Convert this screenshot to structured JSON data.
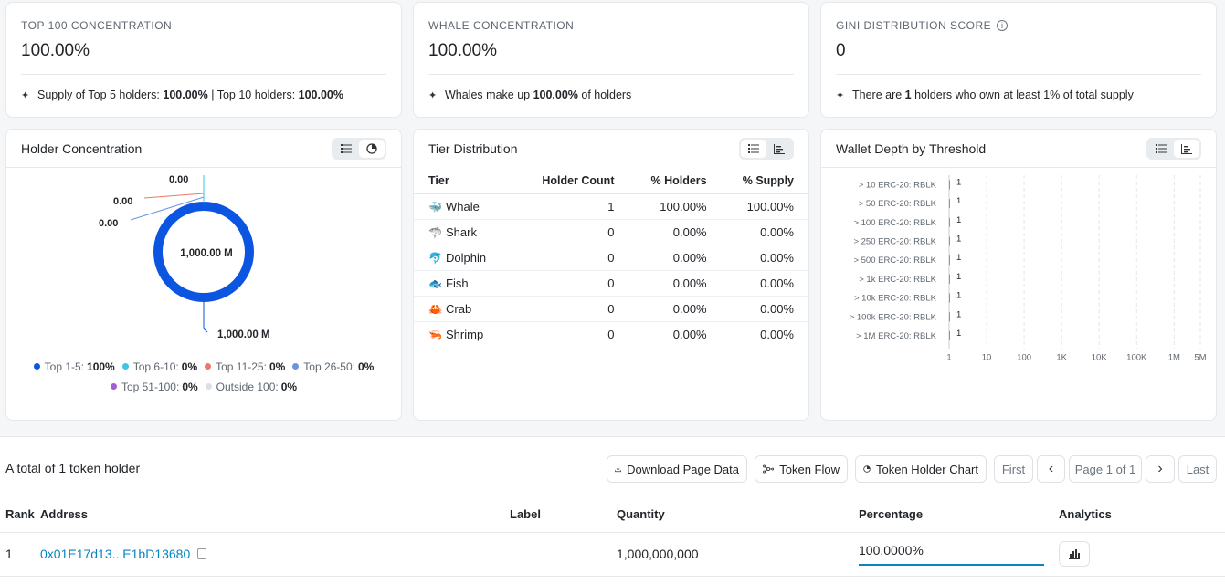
{
  "stats": [
    {
      "label": "TOP 100 CONCENTRATION",
      "value": "100.00%",
      "note": [
        {
          "t": "Supply of Top 5 holders: "
        },
        {
          "t": "100.00%",
          "b": true
        },
        {
          "t": " | Top 10 holders: "
        },
        {
          "t": "100.00%",
          "b": true
        }
      ]
    },
    {
      "label": "WHALE CONCENTRATION",
      "value": "100.00%",
      "note": [
        {
          "t": "Whales make up "
        },
        {
          "t": "100.00%",
          "b": true
        },
        {
          "t": " of holders"
        }
      ]
    },
    {
      "label": "GINI DISTRIBUTION SCORE",
      "value": "0",
      "note": [
        {
          "t": "There are "
        },
        {
          "t": "1",
          "b": true
        },
        {
          "t": " holders who own at least 1% of total supply"
        }
      ]
    }
  ],
  "holder_concentration": {
    "title": "Holder Concentration",
    "center_label": "1,000.00 M",
    "callouts": {
      "a": "0.00",
      "b": "0.00",
      "c": "0.00",
      "bottom": "1,000.00 M"
    },
    "legend": [
      {
        "label": "Top 1-5:",
        "value": "100%",
        "color": "#0b55e0"
      },
      {
        "label": "Top 6-10:",
        "value": "0%",
        "color": "#3bc3e8"
      },
      {
        "label": "Top 11-25:",
        "value": "0%",
        "color": "#ea7a65"
      },
      {
        "label": "Top 26-50:",
        "value": "0%",
        "color": "#6b93e0"
      },
      {
        "label": "Top 51-100:",
        "value": "0%",
        "color": "#a25ddc"
      },
      {
        "label": "Outside 100:",
        "value": "0%",
        "color": "#dbe0e6"
      }
    ]
  },
  "tier_distribution": {
    "title": "Tier Distribution",
    "headers": [
      "Tier",
      "Holder Count",
      "% Holders",
      "% Supply"
    ],
    "rows": [
      {
        "tier": "Whale",
        "icon": "whale-icon",
        "glyph": "🐳",
        "count": "1",
        "holders": "100.00%",
        "supply": "100.00%"
      },
      {
        "tier": "Shark",
        "icon": "shark-icon",
        "glyph": "🦈",
        "count": "0",
        "holders": "0.00%",
        "supply": "0.00%"
      },
      {
        "tier": "Dolphin",
        "icon": "dolphin-icon",
        "glyph": "🐬",
        "count": "0",
        "holders": "0.00%",
        "supply": "0.00%"
      },
      {
        "tier": "Fish",
        "icon": "fish-icon",
        "glyph": "🐟",
        "count": "0",
        "holders": "0.00%",
        "supply": "0.00%"
      },
      {
        "tier": "Crab",
        "icon": "crab-icon",
        "glyph": "🦀",
        "count": "0",
        "holders": "0.00%",
        "supply": "0.00%"
      },
      {
        "tier": "Shrimp",
        "icon": "shrimp-icon",
        "glyph": "🦐",
        "count": "0",
        "holders": "0.00%",
        "supply": "0.00%"
      }
    ]
  },
  "wallet_depth": {
    "title": "Wallet Depth by Threshold"
  },
  "chart_data": {
    "type": "bar",
    "orientation": "horizontal",
    "x_scale": "log",
    "categories": [
      "> 10 ERC-20: RBLK",
      "> 50 ERC-20: RBLK",
      "> 100 ERC-20: RBLK",
      "> 250 ERC-20: RBLK",
      "> 500 ERC-20: RBLK",
      "> 1k ERC-20: RBLK",
      "> 10k ERC-20: RBLK",
      "> 100k ERC-20: RBLK",
      "> 1M ERC-20: RBLK"
    ],
    "values": [
      1,
      1,
      1,
      1,
      1,
      1,
      1,
      1,
      1
    ],
    "x_ticks": [
      "1",
      "10",
      "100",
      "1K",
      "10K",
      "100K",
      "1M",
      "5M"
    ],
    "xlim": [
      1,
      5000000
    ],
    "grid": "vertical dashed",
    "color": "#0b55e0"
  },
  "bottom": {
    "total": "A total of 1 token holder",
    "download": "Download Page Data",
    "token_flow": "Token Flow",
    "holder_chart": "Token Holder Chart",
    "first": "First",
    "page": "Page 1 of 1",
    "last": "Last",
    "headers": {
      "rank": "Rank",
      "address": "Address",
      "label": "Label",
      "quantity": "Quantity",
      "percentage": "Percentage",
      "analytics": "Analytics"
    },
    "rows": [
      {
        "rank": "1",
        "address": "0x01E17d13...E1bD13680",
        "label": "",
        "quantity": "1,000,000,000",
        "percentage": "100.0000%"
      }
    ]
  }
}
